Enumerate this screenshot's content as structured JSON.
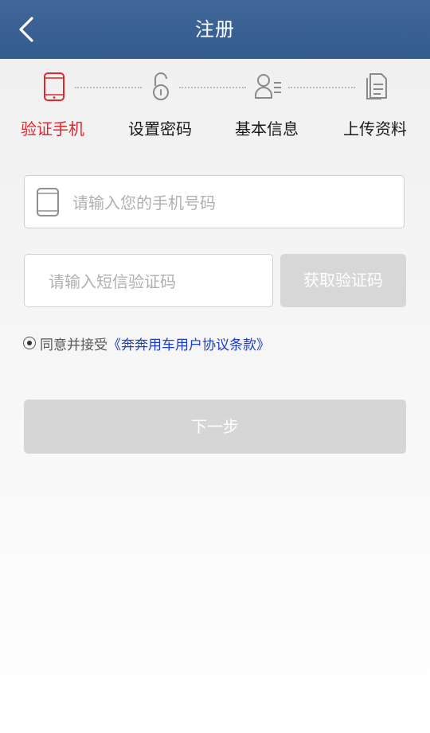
{
  "header": {
    "title": "注册",
    "back_icon": "chevron-left-icon"
  },
  "steps": [
    {
      "label": "验证手机",
      "icon": "phone-icon",
      "active": true
    },
    {
      "label": "设置密码",
      "icon": "lock-icon",
      "active": false
    },
    {
      "label": "基本信息",
      "icon": "user-info-icon",
      "active": false
    },
    {
      "label": "上传资料",
      "icon": "documents-icon",
      "active": false
    }
  ],
  "form": {
    "phone_placeholder": "请输入您的手机号码",
    "phone_value": "",
    "code_placeholder": "请输入短信验证码",
    "code_value": "",
    "get_code_label": "获取验证码"
  },
  "agreement": {
    "prefix": "同意并接受",
    "link_text": "《奔奔用车用户协议条款》",
    "checked": true
  },
  "next_label": "下一步",
  "colors": {
    "header_bg": "#3a6194",
    "active_step": "#e3262d",
    "link": "#1d3cc9",
    "disabled_button": "#d6d6d6"
  }
}
